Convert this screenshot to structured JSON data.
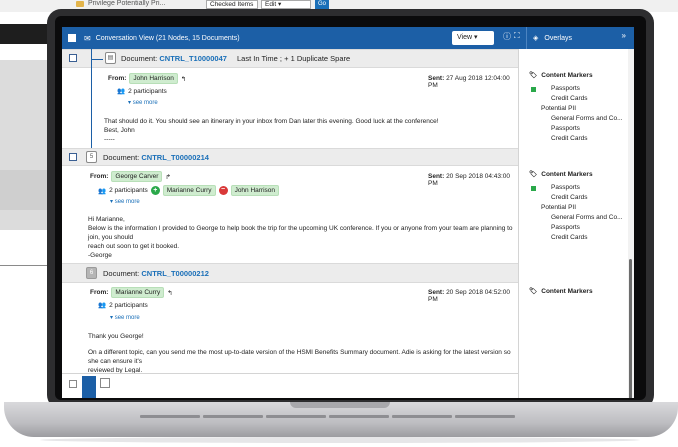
{
  "background": {
    "privilege_label": "Privilege Potentially Pri...",
    "select_checked": "Checked Items",
    "select_edit": "Edit",
    "go_label": "Go"
  },
  "titlebar": {
    "title": "Conversation View (21 Nodes, 15 Documents)",
    "view_label": "View",
    "overlays_label": "Overlays"
  },
  "documents": [
    {
      "label": "Document:",
      "id": "CNTRL_T10000047",
      "extra": "Last In Time ; + 1 Duplicate Spare",
      "from_label": "From:",
      "from": "John Harrison",
      "sent_label": "Sent:",
      "sent": "27 Aug 2018 12:04:00 PM",
      "participants": "2 participants",
      "see_more": "see more",
      "body": [
        "That should do it. You should see an itinerary in your inbox from Dan later this evening. Good luck at the conference!",
        "Best, John",
        "-----"
      ]
    },
    {
      "label": "Document:",
      "id": "CNTRL_T00000214",
      "from_label": "From:",
      "from": "George Carver",
      "sent_label": "Sent:",
      "sent": "20 Sep 2018 04:43:00 PM",
      "participants": "2 participants",
      "added": "Marianne Curry",
      "removed": "John Harrison",
      "see_more": "see more",
      "body": [
        "Hi Marianne,",
        "Below is the information I provided to George to help book the trip for the upcoming UK conference. If you or anyone from your team are planning to join, you should",
        "reach out soon to get it booked.",
        "-George"
      ]
    },
    {
      "label": "Document:",
      "id": "CNTRL_T00000212",
      "from_label": "From:",
      "from": "Marianne Curry",
      "sent_label": "Sent:",
      "sent": "20 Sep 2018 04:52:00 PM",
      "participants": "2 participants",
      "see_more": "see more",
      "body": [
        "Thank you George!",
        "On a different topic, can you send me the most up-to-date version of the HSMI Benefits Summary document. Adie is asking for the latest version so she can ensure it's",
        "reviewed by Legal.",
        "-----"
      ]
    }
  ],
  "overlays": [
    {
      "title": "Content Markers",
      "items": [
        "Passports",
        "Credit Cards",
        "Potential PII",
        "General Forms and Co...",
        "Passports",
        "Credit Cards"
      ]
    },
    {
      "title": "Content Markers",
      "items": [
        "Passports",
        "Credit Cards",
        "Potential PII",
        "General Forms and Co...",
        "Passports",
        "Credit Cards"
      ]
    },
    {
      "title": "Content Markers",
      "items": []
    }
  ],
  "colors": {
    "primary": "#1c5fa6",
    "link": "#1a6fb8",
    "chip_green": "#cfeccf",
    "marker_green": "#2aa84a",
    "remove_red": "#d93838"
  }
}
